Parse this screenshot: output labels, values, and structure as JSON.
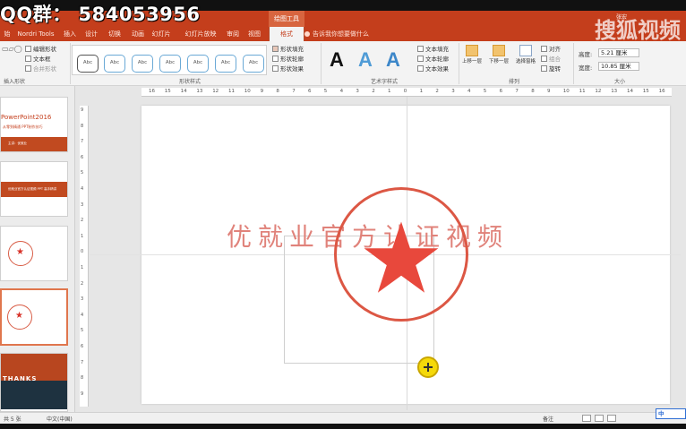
{
  "watermark": {
    "qq_group": "QQ群： 584053956",
    "sohu_logo": "搜狐视频",
    "sohu_sub": "张宏"
  },
  "titlebar": {
    "context_tool": "绘图工具"
  },
  "tabs": [
    {
      "label": "始"
    },
    {
      "label": "Nordri Tools"
    },
    {
      "label": "插入"
    },
    {
      "label": "设计"
    },
    {
      "label": "切换"
    },
    {
      "label": "动画"
    },
    {
      "label": "幻灯片放映"
    },
    {
      "label": "审阅"
    },
    {
      "label": "视图"
    },
    {
      "label": "格式",
      "active": true
    }
  ],
  "tell_me": "告诉我你想要做什么",
  "ribbon": {
    "insert_shapes": {
      "edit_shape": "编辑形状",
      "text_box": "文本框",
      "merge_shapes": "合并形状",
      "label": "插入形状"
    },
    "shape_styles": {
      "samples": [
        "Abc",
        "Abc",
        "Abc",
        "Abc",
        "Abc",
        "Abc",
        "Abc"
      ],
      "fill": "形状填充",
      "outline": "形状轮廓",
      "effects": "形状效果",
      "label": "形状样式"
    },
    "wordart": {
      "samples": [
        "A",
        "A",
        "A"
      ],
      "sample_colors": [
        "#111111",
        "#4f9bd6",
        "#3d87c9"
      ],
      "text_fill": "文本填充",
      "text_outline": "文本轮廓",
      "text_effects": "文本效果",
      "label": "艺术字样式"
    },
    "arrange": {
      "bring_forward": "上移一层",
      "send_backward": "下移一层",
      "selection_pane": "选择窗格",
      "align": "对齐",
      "group": "组合",
      "rotate": "旋转",
      "label": "排列"
    },
    "size": {
      "height_label": "高度:",
      "height_value": "5.21 厘米",
      "width_label": "宽度:",
      "width_value": "10.85 厘米",
      "label": "大小"
    }
  },
  "thumbnails": [
    {
      "title": "PowerPoint2016",
      "subtitle": "从零到精通 PPT制作技巧",
      "bar_text": "主讲：优就业"
    },
    {
      "bar_text": "优就业官方认证视频 PPT 高手精讲"
    },
    {
      "type": "stamp"
    },
    {
      "type": "stamp",
      "selected": true
    },
    {
      "thanks": "THANKS"
    }
  ],
  "ruler": {
    "h_ticks": [
      "16",
      "15",
      "14",
      "13",
      "12",
      "11",
      "10",
      "9",
      "8",
      "7",
      "6",
      "5",
      "4",
      "3",
      "2",
      "1",
      "0",
      "1",
      "2",
      "3",
      "4",
      "5",
      "6",
      "7",
      "8",
      "9",
      "10",
      "11",
      "12",
      "13",
      "14",
      "15",
      "16"
    ],
    "v_ticks": [
      "9",
      "8",
      "7",
      "6",
      "5",
      "4",
      "3",
      "2",
      "1",
      "0",
      "1",
      "2",
      "3",
      "4",
      "5",
      "6",
      "7",
      "8",
      "9"
    ]
  },
  "slide": {
    "stamp_text": "优就业官方认证视频",
    "stamp_color": "#dc5744",
    "star_color": "#e8483c"
  },
  "statusbar": {
    "slide_info": "共 5 张",
    "language": "中文(中国)",
    "notes": "备注",
    "ime": "中"
  }
}
